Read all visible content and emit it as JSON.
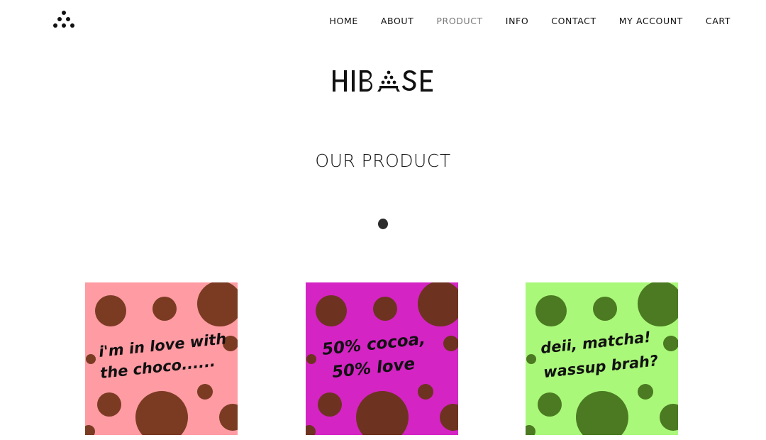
{
  "nav": {
    "items": [
      {
        "label": "HOME",
        "active": false
      },
      {
        "label": "ABOUT",
        "active": false
      },
      {
        "label": "PRODUCT",
        "active": true
      },
      {
        "label": "INFO",
        "active": false
      },
      {
        "label": "CONTACT",
        "active": false
      },
      {
        "label": "MY ACCOUNT",
        "active": false
      },
      {
        "label": "CART",
        "active": false
      }
    ]
  },
  "brand": {
    "name": "HIBASE"
  },
  "section": {
    "title": "OUR PRODUCT"
  },
  "products": [
    {
      "tagline_line1": "i'm in love with",
      "tagline_line2": "the choco......",
      "bg_color": "#ff9ba3",
      "ball_color": "#7a3b22"
    },
    {
      "tagline_line1": "50% cocoa,",
      "tagline_line2": "50% love",
      "bg_color": "#d424c4",
      "ball_color": "#6e3320"
    },
    {
      "tagline_line1": "deii, matcha!",
      "tagline_line2": "wassup brah?",
      "bg_color": "#aaf87a",
      "ball_color": "#4b7a22"
    }
  ]
}
